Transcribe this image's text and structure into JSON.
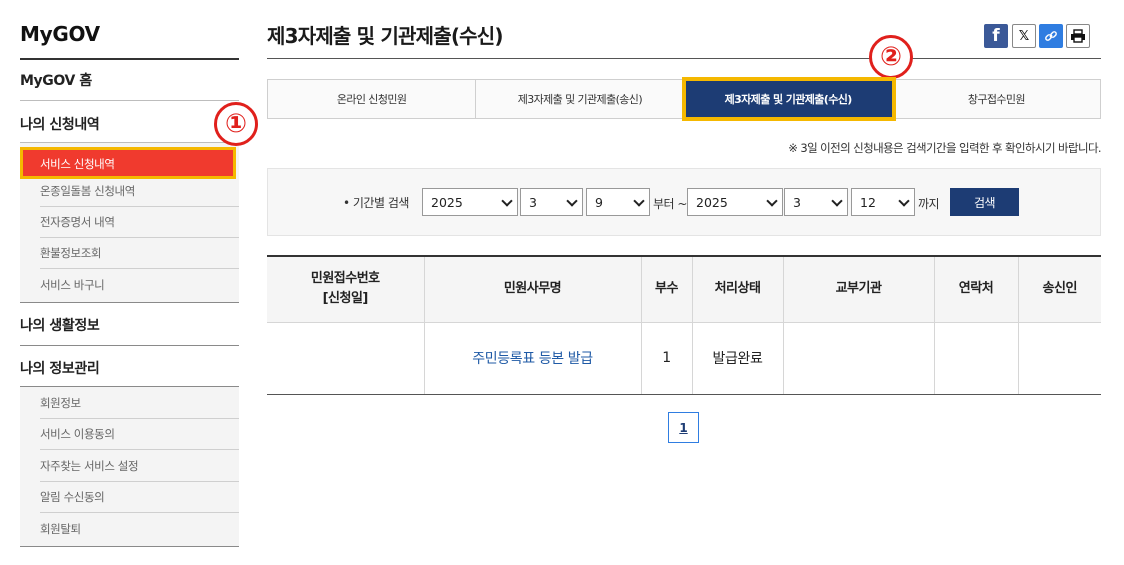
{
  "sidebar": {
    "brand": "MyGOV",
    "home": "MyGOV 홈",
    "group1": {
      "title": "나의 신청내역",
      "items": [
        "서비스 신청내역",
        "온종일돌봄 신청내역",
        "전자증명서 내역",
        "환불정보조회",
        "서비스 바구니"
      ]
    },
    "group2": {
      "title": "나의 생활정보"
    },
    "group3": {
      "title": "나의 정보관리",
      "items": [
        "회원정보",
        "서비스 이용동의",
        "자주찾는 서비스 설정",
        "알림 수신동의",
        "회원탈퇴"
      ]
    }
  },
  "page": {
    "title": "제3자제출 및 기관제출(수신)",
    "share_icons": [
      "facebook-icon",
      "x-icon",
      "link-icon",
      "print-icon"
    ]
  },
  "markers": [
    "①",
    "②"
  ],
  "tabs": [
    "온라인 신청민원",
    "제3자제출 및 기관제출(송신)",
    "제3자제출 및 기관제출(수신)",
    "창구접수민원"
  ],
  "notice": "※ 3일 이전의 신청내용은 검색기간을 입력한 후 확인하시기 바랍니다.",
  "search": {
    "label": "• 기간별 검색",
    "from_year": "2025",
    "from_month": "3",
    "from_day": "9",
    "from_suffix": "부터 ~",
    "to_year": "2025",
    "to_month": "3",
    "to_day": "12",
    "to_suffix": "까지",
    "button": "검색"
  },
  "table": {
    "headers": {
      "receipt_no": "민원접수번호",
      "receipt_sub": "[신청일]",
      "name": "민원사무명",
      "copies": "부수",
      "status": "처리상태",
      "agency": "교부기관",
      "contact": "연락처",
      "sender": "송신인"
    },
    "rows": [
      {
        "receipt_no": "",
        "name": "주민등록표 등본 발급",
        "copies": "1",
        "status": "발급완료",
        "agency": "",
        "contact": "",
        "sender": ""
      }
    ]
  },
  "pagination": {
    "current": "1"
  },
  "colors": {
    "accent_navy": "#1d3c74",
    "active_red": "#f03a2e",
    "highlight_yellow": "#f5b800",
    "marker_red": "#e0201c"
  }
}
